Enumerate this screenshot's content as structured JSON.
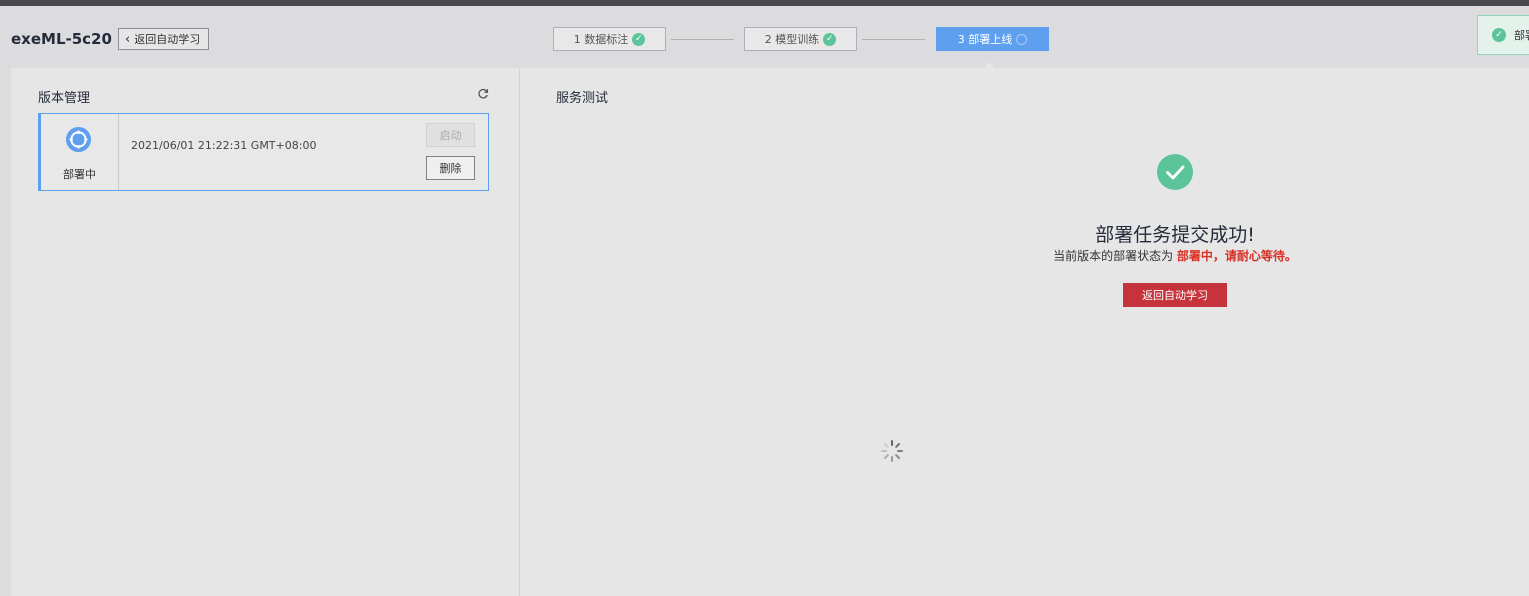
{
  "header": {
    "project_name": "exeML-5c20",
    "back_label": "返回自动学习"
  },
  "steps": [
    {
      "label": "1 数据标注",
      "status": "done"
    },
    {
      "label": "2 模型训练",
      "status": "done"
    },
    {
      "label": "3 部署上线",
      "status": "active"
    }
  ],
  "toast": {
    "text": "部署"
  },
  "version_panel": {
    "title": "版本管理",
    "versions": [
      {
        "status": "部署中",
        "time": "2021/06/01 21:22:31 GMT+08:00",
        "start_label": "启动",
        "delete_label": "删除"
      }
    ]
  },
  "service_panel": {
    "title": "服务测试",
    "success_title": "部署任务提交成功!",
    "status_prefix": "当前版本的部署状态为",
    "status_value": "部署中，请耐心等待。",
    "return_button": "返回自动学习"
  },
  "colors": {
    "accent": "#5e9ff0",
    "success": "#5cc49a",
    "danger": "#c7333b",
    "status_red": "#d93026"
  }
}
